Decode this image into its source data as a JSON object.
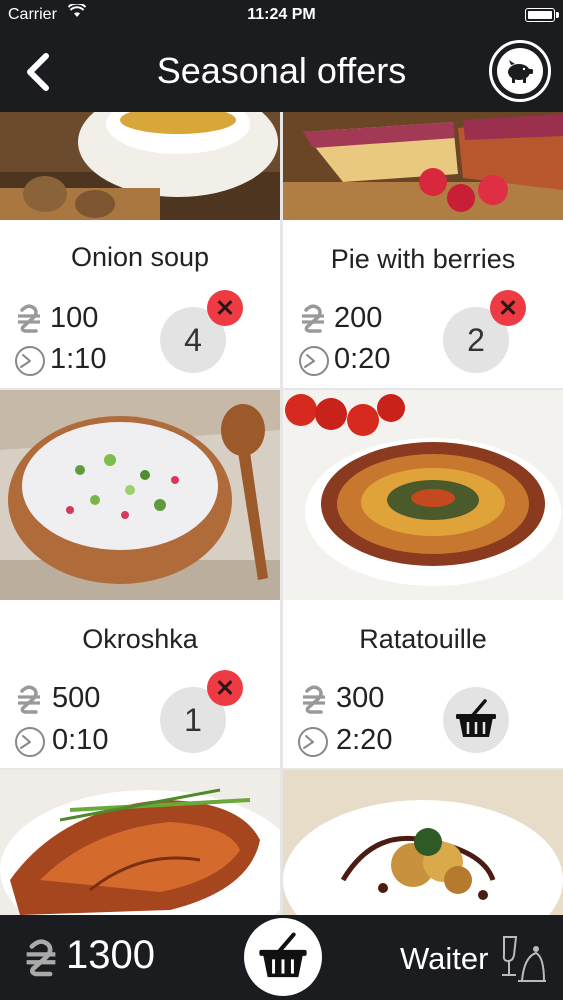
{
  "status_bar": {
    "carrier": "Carrier",
    "time": "11:24 PM"
  },
  "nav": {
    "title": "Seasonal offers",
    "back_icon": "chevron-left-icon",
    "action_icon": "piggy-bank-icon"
  },
  "currency_symbol": "₴",
  "items": [
    {
      "name": "Onion soup",
      "price": "100",
      "time": "1:10",
      "quantity": "4",
      "in_order": true,
      "photo": "onion-soup-photo"
    },
    {
      "name": "Pie with berries",
      "price": "200",
      "time": "0:20",
      "quantity": "2",
      "in_order": true,
      "photo": "berry-pie-photo"
    },
    {
      "name": "Okroshka",
      "price": "500",
      "time": "0:10",
      "quantity": "1",
      "in_order": true,
      "photo": "okroshka-photo"
    },
    {
      "name": "Ratatouille",
      "price": "300",
      "time": "2:20",
      "quantity": "",
      "in_order": false,
      "photo": "ratatouille-photo"
    },
    {
      "photo": "grilled-salmon-photo"
    },
    {
      "photo": "dessert-plate-photo"
    }
  ],
  "footer": {
    "total": "1300",
    "waiter_label": "Waiter"
  },
  "colors": {
    "bar": "#1b1c20",
    "remove": "#ee3a43",
    "badge": "#e3e3e3"
  }
}
